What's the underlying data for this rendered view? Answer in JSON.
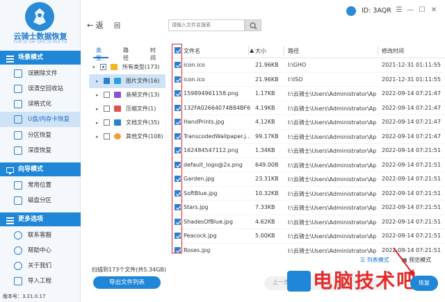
{
  "app": {
    "title": "云骑士数据恢复",
    "subtitle": "YUN QI SHI SHU JU HUI FU",
    "user_id": "ID: 3AQR",
    "version": "版本号：3.21.0.17"
  },
  "window_controls": {
    "menu": "☰",
    "minimize": "—",
    "maximize": "☐",
    "close": "✕"
  },
  "sidebar": {
    "scene_head": "场景模式",
    "scene_items": [
      {
        "label": "误删除文件"
      },
      {
        "label": "误清空回收站"
      },
      {
        "label": "误格式化"
      },
      {
        "label": "U盘/内存卡恢复"
      },
      {
        "label": "分区恢复"
      },
      {
        "label": "深度恢复"
      }
    ],
    "wizard_head": "向导模式",
    "wizard_items": [
      {
        "label": "常用位置"
      },
      {
        "label": "磁盘分区"
      }
    ],
    "more_head": "更多选项",
    "more_items": [
      {
        "label": "联系客服"
      },
      {
        "label": "帮助中心"
      },
      {
        "label": "关于我们"
      },
      {
        "label": "导入工程"
      }
    ]
  },
  "toolbar": {
    "back_label": "返",
    "home_label": "回",
    "search_placeholder": "请输入文件名搜索"
  },
  "tree": {
    "tabs": [
      "类型",
      "路径",
      "时间"
    ],
    "items": [
      {
        "label": "所有类型(173)",
        "color": "#f5b51f"
      },
      {
        "label": "图片文件(16)",
        "color": "#2aa0e0"
      },
      {
        "label": "音频文件(13)",
        "color": "#8b4fd6"
      },
      {
        "label": "压缩文件(1)",
        "color": "#e05252"
      },
      {
        "label": "文档文件(35)",
        "color": "#2a7fd0"
      },
      {
        "label": "其他文件(108)",
        "color": "#f0a030"
      }
    ],
    "scan_info": "扫描到173个文件(共5.34GB)",
    "export_button": "导出文件列表"
  },
  "table": {
    "headers": {
      "name": "文件名",
      "size": "大小",
      "path": "路径",
      "mtime": "修改时间"
    },
    "rows": [
      {
        "name": "icon.ico",
        "size": "21.96KB",
        "path": "I:\\GHO",
        "mtime": "2021-12-31 01:11:55"
      },
      {
        "name": "icon.ico",
        "size": "21.96KB",
        "path": "I:\\ISO",
        "mtime": "2021-12-31 01:11:55"
      },
      {
        "name": "159894961158.png",
        "size": "1.17KB",
        "path": "I:\\云骑士\\Users\\Administrator\\Ap...",
        "mtime": "2022-09-14 07:21:47"
      },
      {
        "name": "132FA02664074B84BF67...",
        "size": "4.19KB",
        "path": "I:\\云骑士\\Users\\Administrator\\Ap...",
        "mtime": "2022-09-14 07:21:47"
      },
      {
        "name": "HandPrints.jpg",
        "size": "4.12KB",
        "path": "I:\\云骑士\\Users\\Administrator\\Ap...",
        "mtime": "2022-09-14 07:21:47"
      },
      {
        "name": "TranscodedWallpaper.j...",
        "size": "99.17KB",
        "path": "I:\\云骑士\\Users\\Administrator\\Ap...",
        "mtime": "2022-09-14 07:21:47"
      },
      {
        "name": "162484547112.png",
        "size": "1.34KB",
        "path": "I:\\云骑士\\Users\\Administrator\\Ap...",
        "mtime": "2022-09-14 07:21:51"
      },
      {
        "name": "default_logo@2x.png",
        "size": "649.00B",
        "path": "I:\\云骑士\\Users\\Administrator\\Ap...",
        "mtime": "2022-09-14 07:21:51"
      },
      {
        "name": "Garden.jpg",
        "size": "23.31KB",
        "path": "I:\\云骑士\\Users\\Administrator\\Ap...",
        "mtime": "2022-09-14 07:21:51"
      },
      {
        "name": "SoftBlue.jpg",
        "size": "10.32KB",
        "path": "I:\\云骑士\\Users\\Administrator\\Ap...",
        "mtime": "2022-09-14 07:21:51"
      },
      {
        "name": "Stars.jpg",
        "size": "7.33KB",
        "path": "I:\\云骑士\\Users\\Administrator\\Ap...",
        "mtime": "2022-09-14 07:21:51"
      },
      {
        "name": "ShadesOfBlue.jpg",
        "size": "4.62KB",
        "path": "I:\\云骑士\\Users\\Administrator\\Ap...",
        "mtime": "2022-09-14 07:21:51"
      },
      {
        "name": "Peacock.jpg",
        "size": "5.00KB",
        "path": "I:\\云骑士\\Users\\Administrator\\Ap...",
        "mtime": "2022-09-14 07:21:51"
      },
      {
        "name": "Roses.jpg",
        "size": "",
        "path": "I:\\云骑士\\Users\\Administrator\\Ap...",
        "mtime": "2022-09-14 07:21:51"
      }
    ]
  },
  "bottom": {
    "list_mode": "列表模式",
    "preview_mode": "预览模式",
    "prev_label": "上一步",
    "next_label": "恢复",
    "watermark": "电脑技术吧"
  },
  "colors": {
    "accent": "#1f86d8",
    "highlight": "#e02020"
  }
}
